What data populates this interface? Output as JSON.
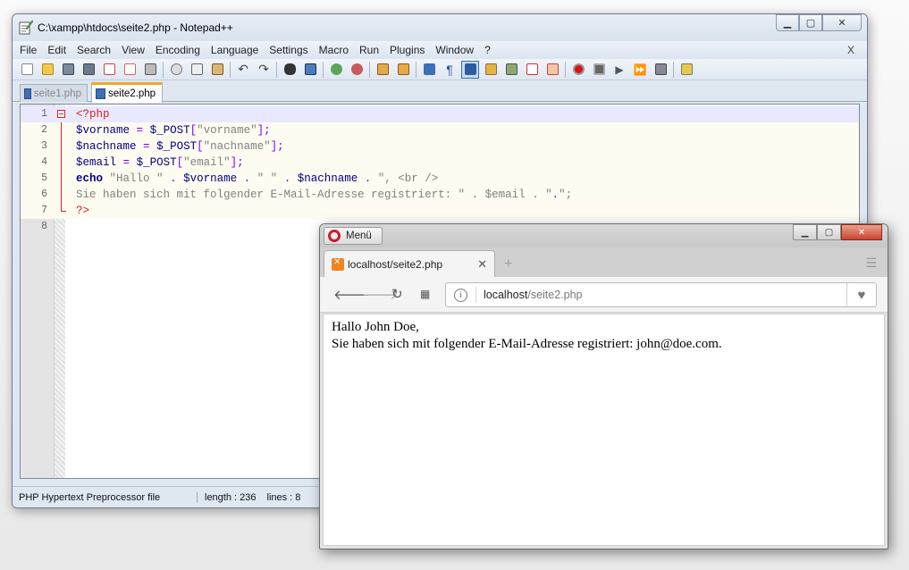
{
  "notepad": {
    "title": "C:\\xampp\\htdocs\\seite2.php - Notepad++",
    "menu": [
      "File",
      "Edit",
      "Search",
      "View",
      "Encoding",
      "Language",
      "Settings",
      "Macro",
      "Run",
      "Plugins",
      "Window",
      "?"
    ],
    "menu_close": "X",
    "tabs": [
      {
        "label": "seite1.php",
        "active": false
      },
      {
        "label": "seite2.php",
        "active": true
      }
    ],
    "lines": [
      {
        "n": "1",
        "text": "<?php"
      },
      {
        "n": "2",
        "text": "$vorname = $_POST[\"vorname\"];"
      },
      {
        "n": "3",
        "text": "$nachname = $_POST[\"nachname\"];"
      },
      {
        "n": "4",
        "text": "$email = $_POST[\"email\"];"
      },
      {
        "n": "5",
        "text": "echo \"Hallo \" . $vorname . \" \" . $nachname . \", <br />"
      },
      {
        "n": "6",
        "text": "Sie haben sich mit folgender E-Mail-Adresse registriert: \" . $email . \".\";"
      },
      {
        "n": "7",
        "text": "?>"
      },
      {
        "n": "8",
        "text": ""
      }
    ],
    "status": {
      "file_type": "PHP Hypertext Preprocessor file",
      "length": "length : 236",
      "lines": "lines : 8"
    }
  },
  "browser": {
    "menu_label": "Menü",
    "tab_title": "localhost/seite2.php",
    "tab_close": "✕",
    "new_tab": "+",
    "address_host": "localhost",
    "address_path": "/seite2.php",
    "content_line1": "Hallo John Doe,",
    "content_line2": "Sie haben sich mit folgender E-Mail-Adresse registriert: john@doe.com."
  },
  "colors": {
    "php_tag": "#d81f26",
    "variable": "#000080",
    "operator": "#8000ff",
    "string": "#808080",
    "opera_red": "#cc1b2b"
  }
}
